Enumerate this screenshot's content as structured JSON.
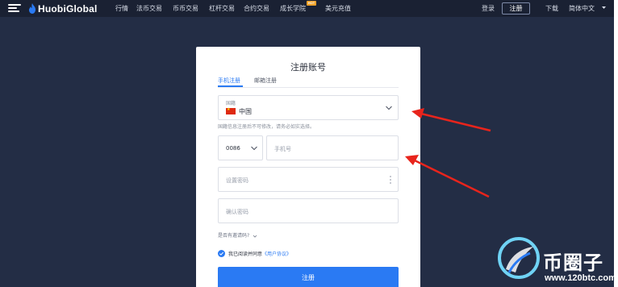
{
  "header": {
    "logo_text": "HuobiGlobal",
    "nav": [
      {
        "label": "行情"
      },
      {
        "label": "法币交易"
      },
      {
        "label": "币币交易"
      },
      {
        "label": "杠杆交易"
      },
      {
        "label": "合约交易"
      },
      {
        "label": "成长学院"
      },
      {
        "label": "美元充值"
      }
    ],
    "hot_badge": "HOT",
    "login": "登录",
    "register": "注册",
    "download": "下载",
    "language": "简体中文"
  },
  "form": {
    "title": "注册账号",
    "tabs": [
      {
        "label": "手机注册",
        "active": true
      },
      {
        "label": "邮箱注册",
        "active": false
      }
    ],
    "country_label": "国籍",
    "country_value": "中国",
    "country_hint": "国籍信息注册后不可修改，请务必如实选择。",
    "phone_code": "0086",
    "phone_placeholder": "手机号",
    "password_placeholder": "设置密码",
    "confirm_placeholder": "确认密码",
    "invite_prompt": "是否有邀请码?",
    "agree_text": "我已阅读并同意",
    "agree_link": "《用户协议》",
    "submit": "注册"
  },
  "watermark": {
    "text": "币圈子",
    "url": "www.120btc.com"
  },
  "colors": {
    "background": "#232d45",
    "accent": "#2a7af3",
    "arrow": "#e8241c"
  }
}
